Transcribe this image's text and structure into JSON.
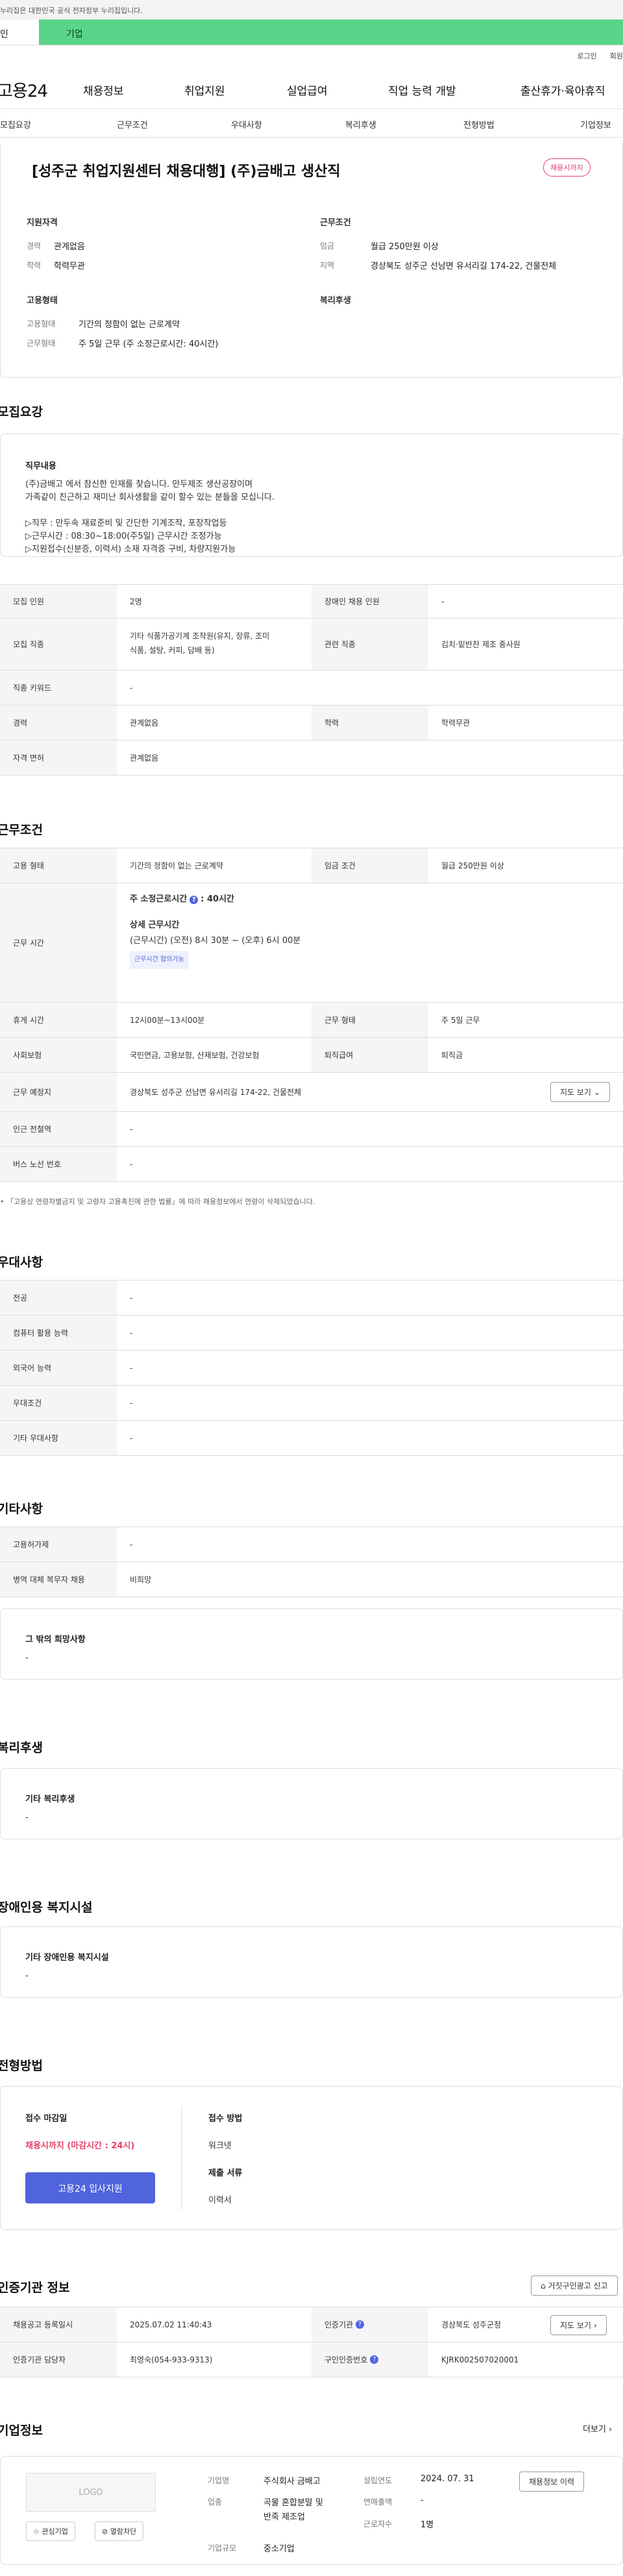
{
  "gov_banner": "누리집은 대한민국 공식 전자정부 누리집입니다.",
  "audience": {
    "personal": "인",
    "company": "기업"
  },
  "util": {
    "login": "로그인",
    "signup": "회원가"
  },
  "header": {
    "logo": "고용24",
    "menu": [
      "채용정보",
      "취업지원",
      "실업급여",
      "직업 능력 개발",
      "출산휴가·육아휴직"
    ]
  },
  "subtabs": [
    "모집요강",
    "근무조건",
    "우대사항",
    "복리후생",
    "전형방법",
    "기업정보"
  ],
  "job": {
    "title": "[성주군 취업지원센터 채용대행] (주)금배고 생산직",
    "deadline_chip": "채용시까지",
    "qual_label": "지원자격",
    "career_k": "경력",
    "career_v": "관계없음",
    "edu_k": "학력",
    "edu_v": "학력무관",
    "cond_label": "근무조건",
    "wage_k": "임금",
    "wage_v": "월급 250만원 이상",
    "region_k": "지역",
    "region_v": "경상북도 성주군 선남면 유서리길 174-22, 건물전체",
    "emp_label": "고용형태",
    "emptype_k": "고용형태",
    "emptype_v": "기간의 정함이 없는 근로계약",
    "worktype_k": "근무형태",
    "worktype_v": "주 5일 근무 (주 소정근로시간: 40시간)",
    "welfare_label": "복리후생"
  },
  "recruit": {
    "title": "모집요강",
    "duty_label": "직무내용",
    "duty_lines": [
      "(주)금배고 에서  참신한 인재를 찾습니다. 만두제조 생산공장이며",
      "가족같이 친근하고 재미난 회사생활을 같이 할수 있는 분들을 모십니다.",
      "",
      "▷직무 : 만두속 재료준비 및  간단한 기계조작, 포장작업등",
      "▷근무시간 : 08:30~18:00(주5일) 근무시간 조정가능",
      "▷지원접수(신분증, 이력서) 소재 자격증 구비, 차량지원가능"
    ],
    "rows": {
      "headcount_k": "모집 인원",
      "headcount_v": "2명",
      "disabled_k": "장애인 채용 인원",
      "disabled_v": "-",
      "job_k": "모집 직종",
      "job_v": [
        "기타 식품가공기계 조작원(유지, 장류, 조미",
        "식품, 설탕, 커피, 담배 등)"
      ],
      "related_k": "관련 직종",
      "related_v": "김치·밑반찬 제조 종사원",
      "keyword_k": "직종 키워드",
      "keyword_v": "-",
      "career_k": "경력",
      "career_v": "관계없음",
      "edu_k": "학력",
      "edu_v": "학력무관",
      "license_k": "자격 면허",
      "license_v": "관계없음"
    }
  },
  "work": {
    "title": "근무조건",
    "emptype_k": "고용 형태",
    "emptype_v": "기간의 정함이 없는 근로계약",
    "wage_k": "임금 조건",
    "wage_v": "월급 250만원 이상",
    "hours_k": "근무 시간",
    "hours_weekly": "주 소정근로시간",
    "hours_weekly_v": ": 40시간",
    "hours_detail_label": "상세 근무시간",
    "hours_detail_v": "(근무시간) (오전) 8시 30분 ~ (오후) 6시 00분",
    "hours_tag": "근무시간 협의가능",
    "break_k": "휴게 시간",
    "break_v": "12시00분~13시00분",
    "form_k": "근무 형태",
    "form_v": "주 5일 근무",
    "insurance_k": "사회보험",
    "insurance_v": "국민연금, 고용보험, 산재보험, 건강보험",
    "severance_k": "퇴직급여",
    "severance_v": "퇴직금",
    "place_k": "근무 예정지",
    "place_v": "경상북도 성주군 선남면 유서리길 174-22, 건물전체",
    "map_btn": "지도 보기",
    "subway_k": "인근 전철역",
    "subway_v": "-",
    "bus_k": "버스 노선 번호",
    "bus_v": "-",
    "note": "「고용상 연령차별금지 및 고령자 고용촉진에 관한 법률」에 따라 채용정보에서 연령이 삭제되었습니다."
  },
  "pref": {
    "title": "우대사항",
    "major_k": "전공",
    "major_v": "-",
    "computer_k": "컴퓨터 활용 능력",
    "computer_v": "-",
    "lang_k": "외국어 능력",
    "lang_v": "-",
    "cond_k": "우대조건",
    "cond_v": "-",
    "etc_k": "기타 우대사항",
    "etc_v": "-"
  },
  "etc": {
    "title": "기타사항",
    "subsidy_k": "고용허가제",
    "subsidy_v": "-",
    "military_k": "병역 대체 복무자 채용",
    "military_v": "비희망",
    "other_label": "그 밖의 희망사항",
    "other_v": "-"
  },
  "welfare": {
    "title": "복리후생",
    "label": "기타 복리후생",
    "value": "-"
  },
  "facility": {
    "title": "장애인용 복지시설",
    "label": "기타 장애인용 복지시설",
    "value": "-"
  },
  "screening": {
    "title": "전형방법",
    "deadline_label": "접수 마감일",
    "deadline_v": "채용시까지 (마감시간 : 24시)",
    "apply_btn": "고용24 입사지원",
    "method_label": "접수 방법",
    "method_v": "워크넷",
    "docs_label": "제출 서류",
    "docs_v": "이력서"
  },
  "cert": {
    "title": "인증기관 정보",
    "report_btn": "거짓구인광고 신고",
    "registered_k": "채용공고 등록일시",
    "registered_v": "2025.07.02 11:40:43",
    "agency_k": "인증기관",
    "agency_v": "경상북도 성주군청",
    "map_btn": "지도 보기",
    "manager_k": "인증기관 담당자",
    "manager_v": "최영숙(054-933-9313)",
    "auth_k": "구인인증번호",
    "auth_v": "KJRK002507020001"
  },
  "company": {
    "title": "기업정보",
    "more": "더보기",
    "logo_text": "LOGO",
    "fav_btn": "관심기업",
    "block_btn": "열람차단",
    "name_k": "기업명",
    "name_v": "주식회사 금배고",
    "industry_k": "업종",
    "industry_v": [
      "곡물 혼합분말 및",
      "반죽 제조업"
    ],
    "size_k": "기업규모",
    "size_v": "중소기업",
    "founded_k": "설립연도",
    "founded_v": "2024. 07. 31",
    "revenue_k": "연매출액",
    "revenue_v": "-",
    "staff_k": "근로자수",
    "staff_v": "1명",
    "history_btn": "채용정보 이력"
  }
}
